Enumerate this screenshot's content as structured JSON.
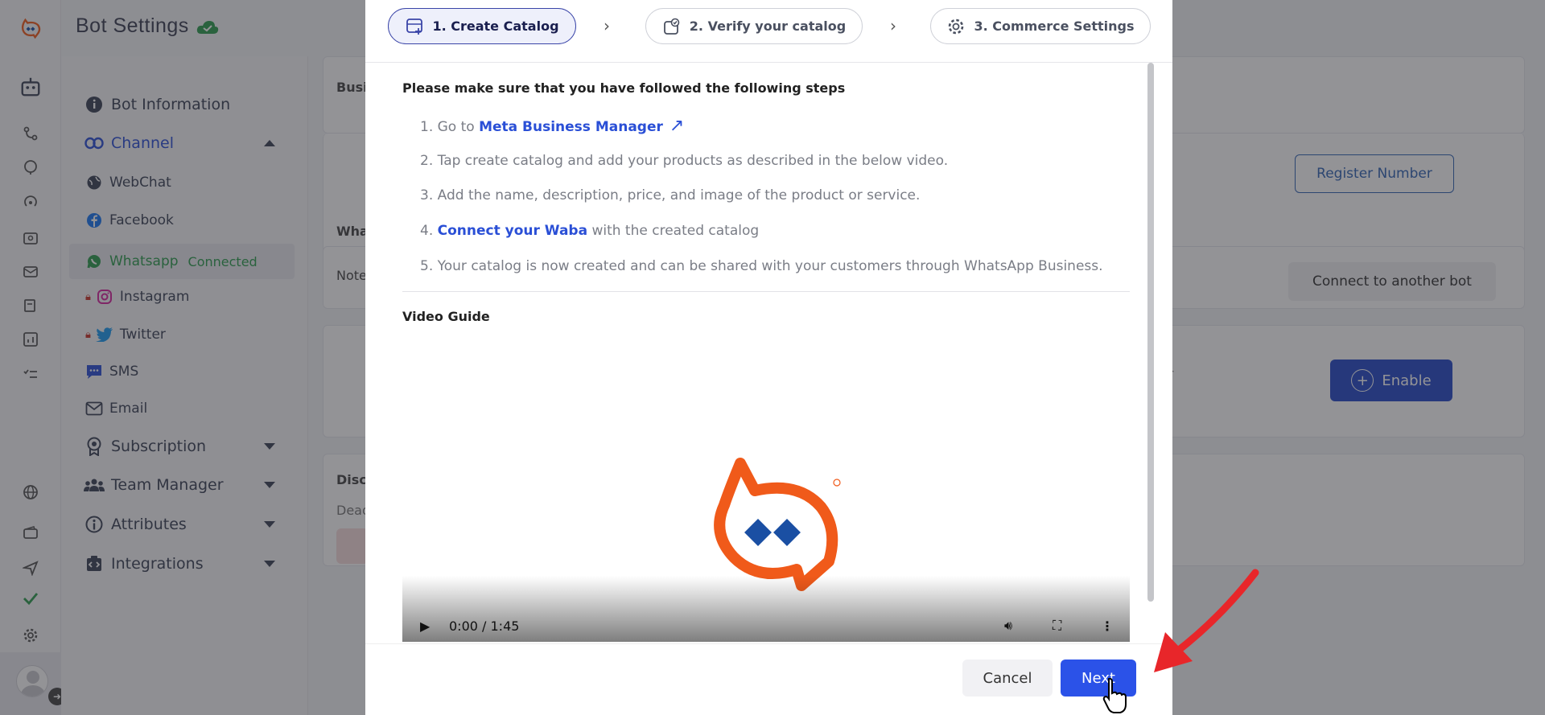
{
  "app": {
    "title": "Bot Settings"
  },
  "sidebar": {
    "items": [
      {
        "label": "Bot Information",
        "icon": "info-icon"
      },
      {
        "label": "Channel",
        "icon": "link-icon"
      },
      {
        "label": "Subscription",
        "icon": "badge-icon"
      },
      {
        "label": "Team Manager",
        "icon": "team-icon"
      },
      {
        "label": "Attributes",
        "icon": "attribute-icon"
      },
      {
        "label": "Integrations",
        "icon": "integration-icon"
      }
    ],
    "channels": [
      {
        "label": "WebChat",
        "icon": "globe-icon"
      },
      {
        "label": "Facebook",
        "icon": "facebook-icon"
      },
      {
        "label": "Whatsapp",
        "status": "Connected",
        "icon": "whatsapp-icon"
      },
      {
        "label": "Instagram",
        "icon": "instagram-icon",
        "locked": true
      },
      {
        "label": "Twitter",
        "icon": "twitter-icon",
        "locked": true
      },
      {
        "label": "SMS",
        "icon": "sms-icon"
      },
      {
        "label": "Email",
        "icon": "email-icon"
      }
    ]
  },
  "background": {
    "card_labels": [
      "Busi",
      "Wha",
      "Note",
      "Disc",
      "Dead"
    ],
    "register_label": "Register Number",
    "connect_other_label": "Connect to another bot",
    "enable_label": "Enable",
    "partial_text": "or"
  },
  "modal": {
    "steps": [
      {
        "label": "1. Create Catalog",
        "icon": "catalog-icon"
      },
      {
        "label": "2. Verify your catalog",
        "icon": "verify-catalog-icon"
      },
      {
        "label": "3. Commerce Settings",
        "icon": "settings-icon"
      }
    ],
    "intro": "Please make sure that you have followed the following steps",
    "instructions": {
      "s1_prefix": "1. Go to ",
      "s1_link": "Meta Business Manager",
      "s2": "2. Tap create catalog and add your products as described in the below video.",
      "s3": "3. Add the name, description, price, and image of the product or service.",
      "s4_prefix": "4. ",
      "s4_link": "Connect your Waba",
      "s4_suffix": " with the created catalog",
      "s5": "5. Your catalog is now created and can be shared with your customers through WhatsApp Business."
    },
    "video_title": "Video Guide",
    "video_time": "0:00 / 1:45",
    "cancel_label": "Cancel",
    "next_label": "Next"
  },
  "colors": {
    "accent": "#2b52e8",
    "brand": "#f05a1a",
    "connected": "#2d9c4e",
    "annotation": "#e8262a"
  }
}
